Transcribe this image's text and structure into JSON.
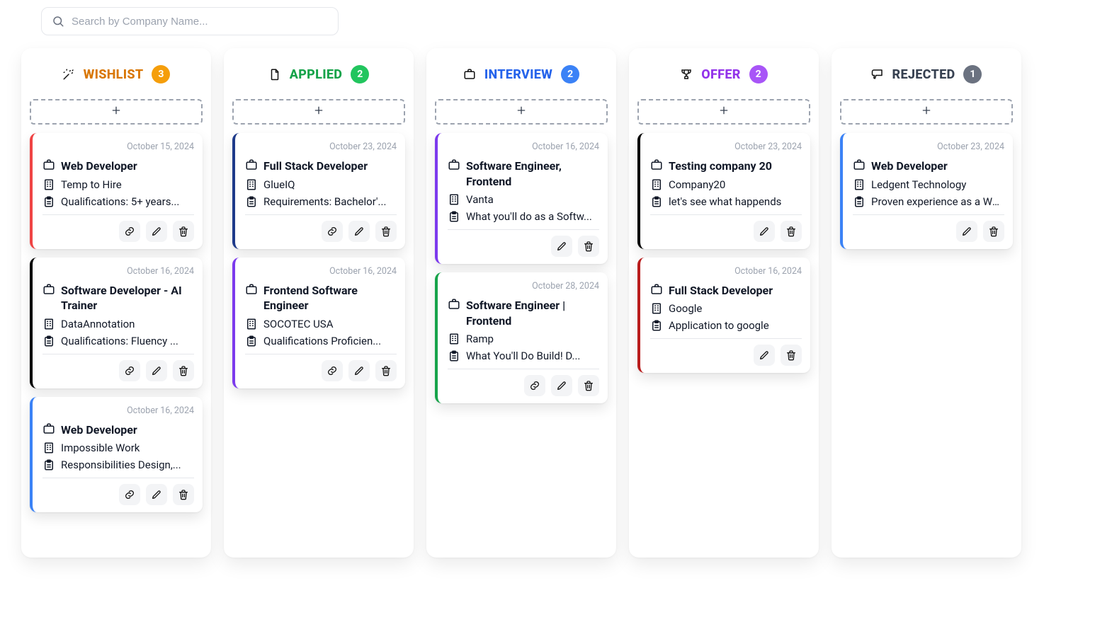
{
  "search": {
    "placeholder": "Search by Company Name..."
  },
  "columns": [
    {
      "key": "wishlist",
      "title": "WISHLIST",
      "count": "3",
      "icon": "wand-icon",
      "cssClass": "c-wishlist",
      "cards": [
        {
          "date": "October 15, 2024",
          "title": "Web Developer",
          "company": "Temp to Hire",
          "desc": "Qualifications: 5+ years...",
          "accent": "#ef4444",
          "hasLink": true
        },
        {
          "date": "October 16, 2024",
          "title": "Software Developer - AI Trainer",
          "company": "DataAnnotation",
          "desc": "Qualifications: Fluency ...",
          "accent": "#000000",
          "hasLink": true
        },
        {
          "date": "October 16, 2024",
          "title": "Web Developer",
          "company": "Impossible Work",
          "desc": "Responsibilities Design,...",
          "accent": "#3b82f6",
          "hasLink": true
        }
      ]
    },
    {
      "key": "applied",
      "title": "APPLIED",
      "count": "2",
      "icon": "file-icon",
      "cssClass": "c-applied",
      "cards": [
        {
          "date": "October 23, 2024",
          "title": "Full Stack Developer",
          "company": "GlueIQ",
          "desc": "Requirements: Bachelor'...",
          "accent": "#1e3a8a",
          "hasLink": true
        },
        {
          "date": "October 16, 2024",
          "title": "Frontend Software Engineer",
          "company": "SOCOTEC USA",
          "desc": "Qualifications Proficien...",
          "accent": "#7c3aed",
          "hasLink": true
        }
      ]
    },
    {
      "key": "interview",
      "title": "INTERVIEW",
      "count": "2",
      "icon": "briefcase-icon",
      "cssClass": "c-interview",
      "cards": [
        {
          "date": "October 16, 2024",
          "title": "Software Engineer, Frontend",
          "company": "Vanta",
          "desc": "What you'll do as a Softw...",
          "accent": "#7c3aed",
          "hasLink": false
        },
        {
          "date": "October 28, 2024",
          "title": "Software Engineer | Frontend",
          "company": "Ramp",
          "desc": "What You'll Do Build! D...",
          "accent": "#16a34a",
          "hasLink": true
        }
      ]
    },
    {
      "key": "offer",
      "title": "OFFER",
      "count": "2",
      "icon": "trophy-icon",
      "cssClass": "c-offer",
      "cards": [
        {
          "date": "October 23, 2024",
          "title": "Testing company 20",
          "company": "Company20",
          "desc": "let's see what happends",
          "accent": "#000000",
          "hasLink": false
        },
        {
          "date": "October 16, 2024",
          "title": "Full Stack Developer",
          "company": "Google",
          "desc": "Application to google",
          "accent": "#b91c1c",
          "hasLink": false
        }
      ]
    },
    {
      "key": "rejected",
      "title": "REJECTED",
      "count": "1",
      "icon": "thumbs-down-icon",
      "cssClass": "c-rejected",
      "cards": [
        {
          "date": "October 23, 2024",
          "title": "Web Developer",
          "company": "Ledgent Technology",
          "desc": "Proven experience as a We...",
          "accent": "#3b82f6",
          "hasLink": false
        }
      ]
    }
  ]
}
